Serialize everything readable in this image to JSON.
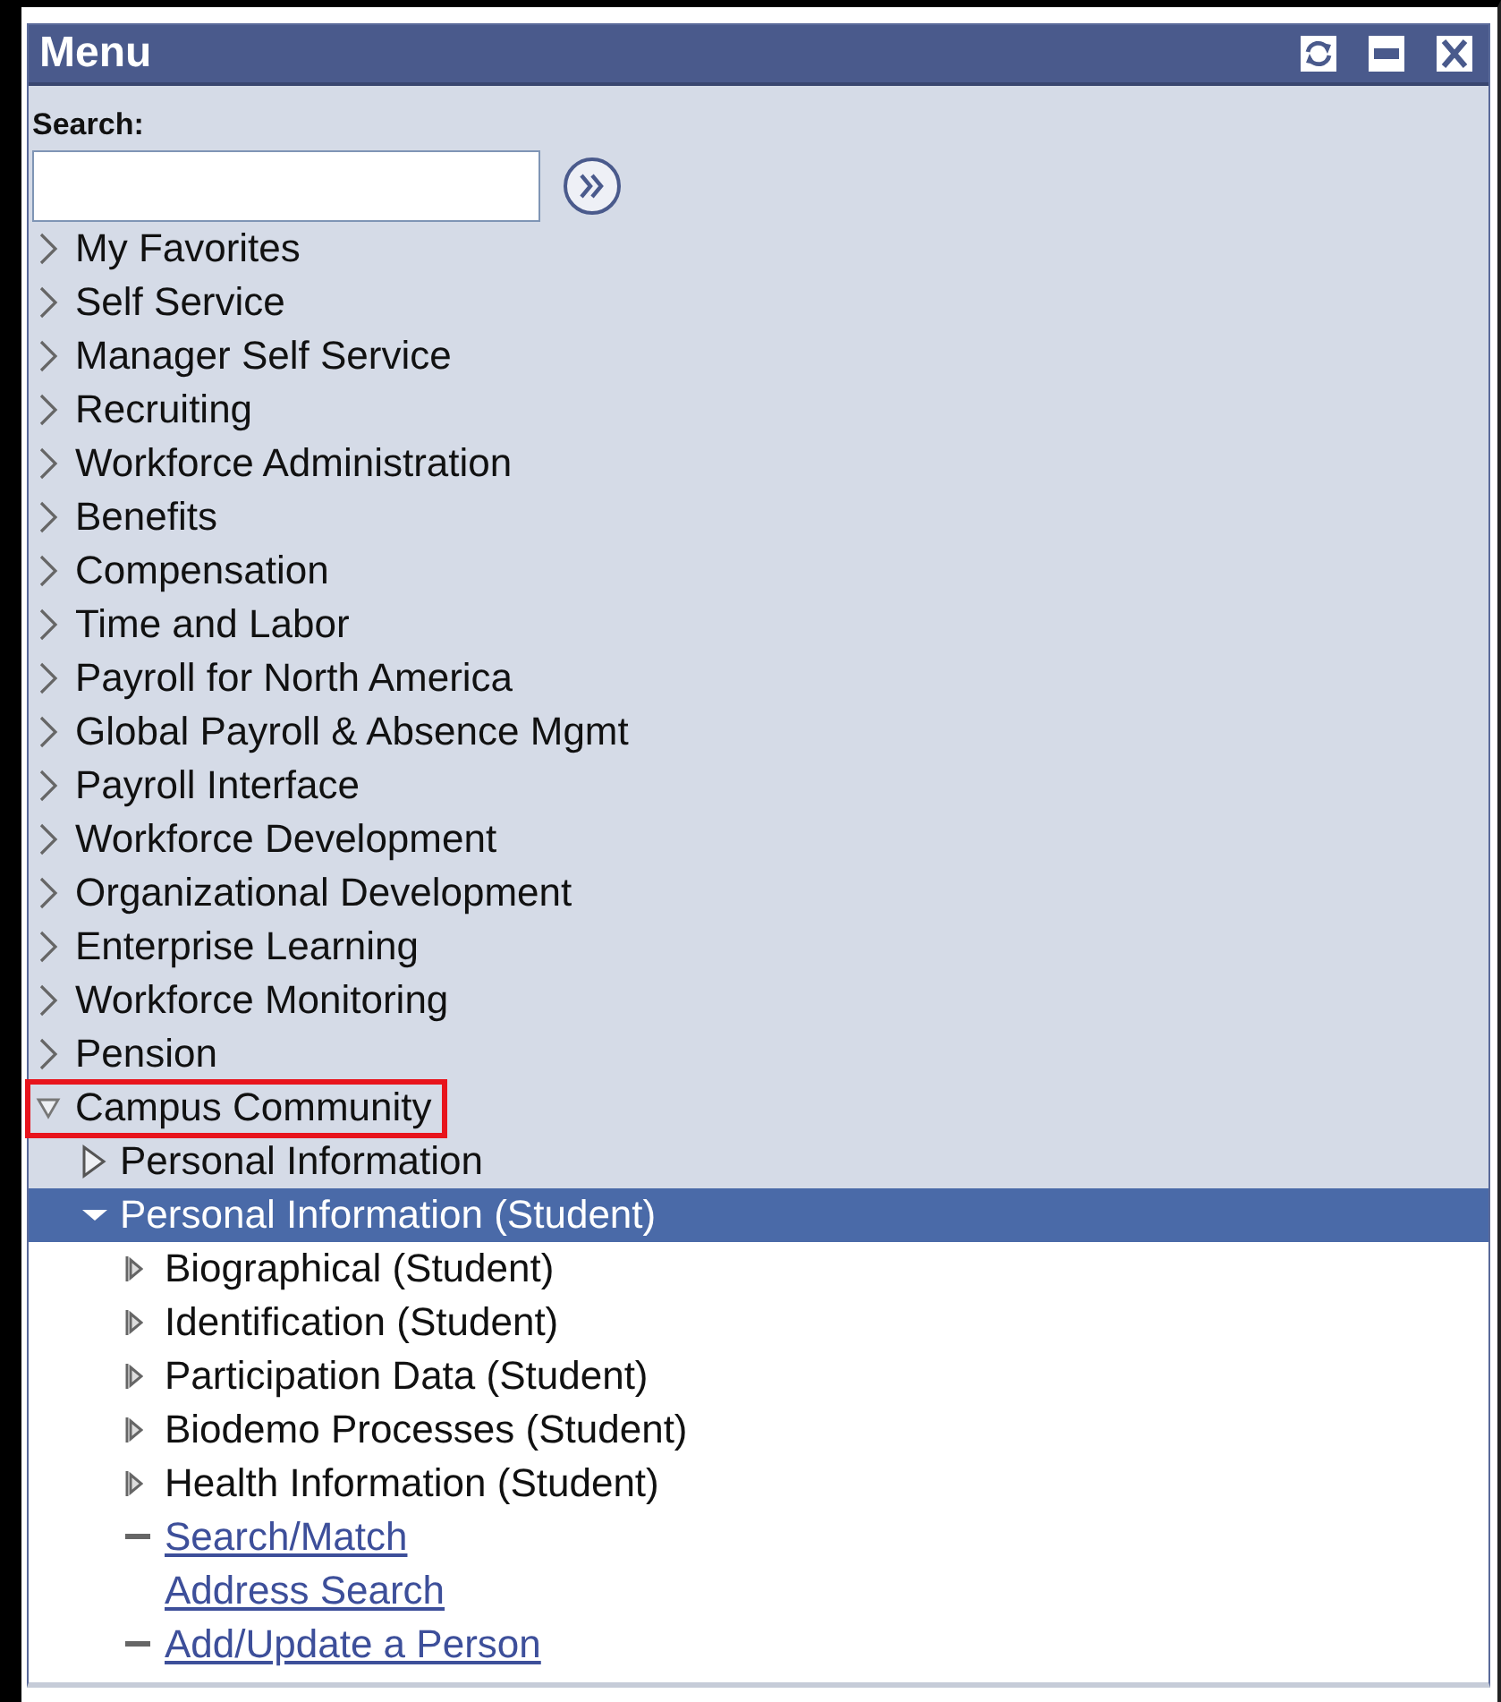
{
  "window": {
    "title": "Menu"
  },
  "search": {
    "label": "Search:"
  },
  "items": [
    {
      "label": "My Favorites",
      "kind": "folder",
      "expanded": false,
      "selected": false,
      "outlined": false
    },
    {
      "label": "Self Service",
      "kind": "folder",
      "expanded": false,
      "selected": false,
      "outlined": false
    },
    {
      "label": "Manager Self Service",
      "kind": "folder",
      "expanded": false,
      "selected": false,
      "outlined": false
    },
    {
      "label": "Recruiting",
      "kind": "folder",
      "expanded": false,
      "selected": false,
      "outlined": false
    },
    {
      "label": "Workforce Administration",
      "kind": "folder",
      "expanded": false,
      "selected": false,
      "outlined": false
    },
    {
      "label": "Benefits",
      "kind": "folder",
      "expanded": false,
      "selected": false,
      "outlined": false
    },
    {
      "label": "Compensation",
      "kind": "folder",
      "expanded": false,
      "selected": false,
      "outlined": false
    },
    {
      "label": "Time and Labor",
      "kind": "folder",
      "expanded": false,
      "selected": false,
      "outlined": false
    },
    {
      "label": "Payroll for North America",
      "kind": "folder",
      "expanded": false,
      "selected": false,
      "outlined": false
    },
    {
      "label": "Global Payroll & Absence Mgmt",
      "kind": "folder",
      "expanded": false,
      "selected": false,
      "outlined": false
    },
    {
      "label": "Payroll Interface",
      "kind": "folder",
      "expanded": false,
      "selected": false,
      "outlined": false
    },
    {
      "label": "Workforce Development",
      "kind": "folder",
      "expanded": false,
      "selected": false,
      "outlined": false
    },
    {
      "label": "Organizational Development",
      "kind": "folder",
      "expanded": false,
      "selected": false,
      "outlined": false
    },
    {
      "label": "Enterprise Learning",
      "kind": "folder",
      "expanded": false,
      "selected": false,
      "outlined": false
    },
    {
      "label": "Workforce Monitoring",
      "kind": "folder",
      "expanded": false,
      "selected": false,
      "outlined": false
    },
    {
      "label": "Pension",
      "kind": "folder",
      "expanded": false,
      "selected": false,
      "outlined": false
    },
    {
      "label": "Campus Community",
      "kind": "folder",
      "expanded": true,
      "selected": false,
      "outlined": true,
      "children": [
        {
          "label": "Personal Information",
          "kind": "folder",
          "expanded": false,
          "selected": false,
          "outlined": false
        },
        {
          "label": "Personal Information (Student)",
          "kind": "folder",
          "expanded": true,
          "selected": true,
          "outlined": false,
          "children": [
            {
              "label": "Biographical (Student)",
              "kind": "folder",
              "expanded": false,
              "selected": false,
              "outlined": false
            },
            {
              "label": "Identification (Student)",
              "kind": "folder",
              "expanded": false,
              "selected": false,
              "outlined": false
            },
            {
              "label": "Participation Data (Student)",
              "kind": "folder",
              "expanded": false,
              "selected": false,
              "outlined": false
            },
            {
              "label": "Biodemo Processes (Student)",
              "kind": "folder",
              "expanded": false,
              "selected": false,
              "outlined": false
            },
            {
              "label": "Health Information (Student)",
              "kind": "folder",
              "expanded": false,
              "selected": false,
              "outlined": false
            },
            {
              "label": "Search/Match",
              "kind": "link",
              "bullet": true,
              "selected": false,
              "outlined": false
            },
            {
              "label": "Address Search",
              "kind": "link",
              "bullet": false,
              "selected": false,
              "outlined": false
            },
            {
              "label": "Add/Update a Person",
              "kind": "link",
              "bullet": true,
              "selected": false,
              "outlined": false
            }
          ]
        }
      ]
    }
  ]
}
